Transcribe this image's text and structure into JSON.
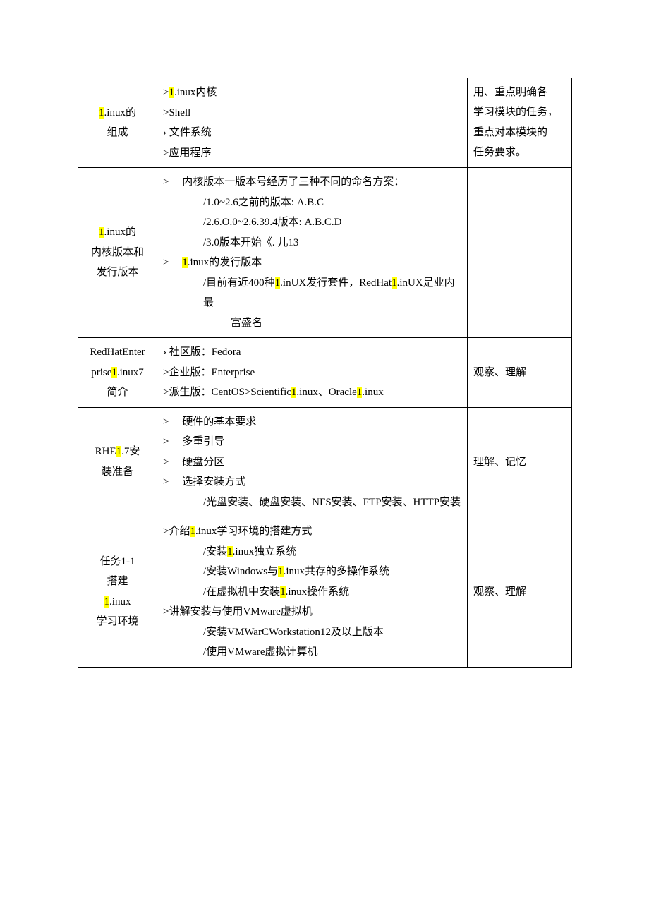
{
  "rows": [
    {
      "label_lines": [
        [
          {
            "t": "1",
            "hl": true
          },
          {
            "t": ".inux的"
          }
        ],
        [
          {
            "t": "组成"
          }
        ]
      ],
      "content": [
        {
          "cls": "ind0",
          "parts": [
            {
              "t": ">"
            },
            {
              "t": "1",
              "hl": true
            },
            {
              "t": ".inux内核"
            }
          ]
        },
        {
          "cls": "ind0",
          "parts": [
            {
              "t": ">Shell"
            }
          ]
        },
        {
          "cls": "ind0",
          "parts": [
            {
              "t": "› 文件系统"
            }
          ]
        },
        {
          "cls": "ind0",
          "parts": [
            {
              "t": ">应用程序"
            }
          ]
        }
      ],
      "notes": [
        {
          "parts": [
            {
              "t": "用、重点明确各"
            }
          ]
        },
        {
          "parts": [
            {
              "t": "学习模块的任务，"
            }
          ]
        },
        {
          "parts": [
            {
              "t": "重点对本模块的"
            }
          ]
        },
        {
          "parts": [
            {
              "t": "任务要求。"
            }
          ]
        }
      ],
      "notes_no_top": true
    },
    {
      "label_lines": [
        [
          {
            "t": "1",
            "hl": true
          },
          {
            "t": ".inux的"
          }
        ],
        [
          {
            "t": "内核版本和"
          }
        ],
        [
          {
            "t": "发行版本"
          }
        ]
      ],
      "content": [
        {
          "cls": "ind1",
          "parts": [
            {
              "t": ">　 内核版本一版本号经历了三种不同的命名方案："
            }
          ]
        },
        {
          "cls": "ind2",
          "parts": [
            {
              "t": "/1.0~2.6之前的版本: A.B.C"
            }
          ]
        },
        {
          "cls": "ind2",
          "parts": [
            {
              "t": "/2.6.O.0~2.6.39.4版本: A.B.C.D"
            }
          ]
        },
        {
          "cls": "ind2",
          "parts": [
            {
              "t": "/3.0版本开始《. 儿13"
            }
          ]
        },
        {
          "cls": "ind1",
          "parts": [
            {
              "t": ">　 "
            },
            {
              "t": "1",
              "hl": true
            },
            {
              "t": ".inux的发行版本"
            }
          ]
        },
        {
          "cls": "ind2",
          "parts": [
            {
              "t": "/目前有近400种"
            },
            {
              "t": "1",
              "hl": true
            },
            {
              "t": ".inUX发行套件，RedHat"
            },
            {
              "t": "1",
              "hl": true
            },
            {
              "t": ".inUX是业内最"
            }
          ]
        },
        {
          "cls": "ind3",
          "parts": [
            {
              "t": "富盛名"
            }
          ]
        }
      ],
      "notes": []
    },
    {
      "label_lines": [
        [
          {
            "t": "RedHatEnter"
          }
        ],
        [
          {
            "t": "prise"
          },
          {
            "t": "1",
            "hl": true
          },
          {
            "t": ".inux7"
          }
        ],
        [
          {
            "t": "简介"
          }
        ]
      ],
      "content": [
        {
          "cls": "ind0",
          "parts": [
            {
              "t": "› 社区版：Fedora"
            }
          ]
        },
        {
          "cls": "ind0",
          "parts": [
            {
              "t": ">企业版：Enterprise"
            }
          ]
        },
        {
          "cls": "ind0",
          "parts": [
            {
              "t": ">派生版：CentOS>Scientific"
            },
            {
              "t": "1",
              "hl": true
            },
            {
              "t": ".inux、Oracle"
            },
            {
              "t": "1",
              "hl": true
            },
            {
              "t": ".inux"
            }
          ]
        }
      ],
      "notes": [
        {
          "parts": [
            {
              "t": "观察、理解"
            }
          ]
        }
      ]
    },
    {
      "label_lines": [
        [
          {
            "t": "RHE"
          },
          {
            "t": "1",
            "hl": true
          },
          {
            "t": ".7安"
          }
        ],
        [
          {
            "t": "装准备"
          }
        ]
      ],
      "content": [
        {
          "cls": "ind1",
          "parts": [
            {
              "t": ">　 硬件的基本要求"
            }
          ]
        },
        {
          "cls": "ind1",
          "parts": [
            {
              "t": ">　 多重引导"
            }
          ]
        },
        {
          "cls": "ind1",
          "parts": [
            {
              "t": ">　 硬盘分区"
            }
          ]
        },
        {
          "cls": "ind1",
          "parts": [
            {
              "t": ">　 选择安装方式"
            }
          ]
        },
        {
          "cls": "ind2",
          "parts": [
            {
              "t": "/光盘安装、硬盘安装、NFS安装、FTP安装、HTTP安装"
            }
          ]
        }
      ],
      "notes": [
        {
          "parts": [
            {
              "t": "理解、记忆"
            }
          ]
        }
      ]
    },
    {
      "label_lines": [
        [
          {
            "t": "任务1-1"
          }
        ],
        [
          {
            "t": "搭建"
          }
        ],
        [
          {
            "t": "1",
            "hl": true
          },
          {
            "t": ".inux"
          }
        ],
        [
          {
            "t": "学习环境"
          }
        ]
      ],
      "content": [
        {
          "cls": "ind0",
          "parts": [
            {
              "t": ">介绍"
            },
            {
              "t": "1",
              "hl": true
            },
            {
              "t": ".inux学习环境的搭建方式"
            }
          ]
        },
        {
          "cls": "ind2",
          "parts": [
            {
              "t": "/安装"
            },
            {
              "t": "1",
              "hl": true
            },
            {
              "t": ".inux独立系统"
            }
          ]
        },
        {
          "cls": "ind2",
          "parts": [
            {
              "t": "/安装Windows与"
            },
            {
              "t": "1",
              "hl": true
            },
            {
              "t": ".inux共存的多操作系统"
            }
          ]
        },
        {
          "cls": "ind2",
          "parts": [
            {
              "t": "/在虚拟机中安装"
            },
            {
              "t": "1",
              "hl": true
            },
            {
              "t": ".inux操作系统"
            }
          ]
        },
        {
          "cls": "ind0",
          "parts": [
            {
              "t": ">讲解安装与使用VMware虚拟机"
            }
          ]
        },
        {
          "cls": "ind2",
          "parts": [
            {
              "t": "/安装VMWarCWorkstation12及以上版本"
            }
          ]
        },
        {
          "cls": "ind2",
          "parts": [
            {
              "t": "/使用VMware虚拟计算机"
            }
          ]
        }
      ],
      "notes": [
        {
          "parts": [
            {
              "t": "观察、理解"
            }
          ]
        }
      ]
    }
  ]
}
